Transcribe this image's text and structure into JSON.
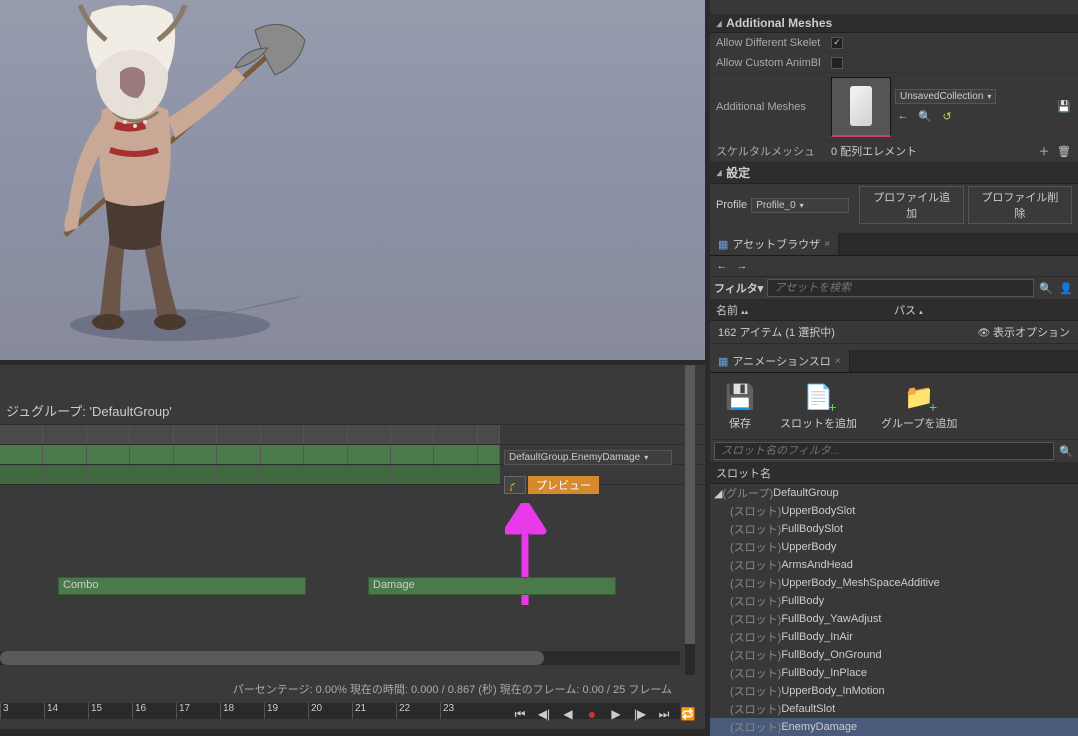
{
  "details": {
    "additional_meshes_header": "Additional Meshes",
    "allow_different_skeletons_label": "Allow Different Skelet",
    "allow_different_skeletons": true,
    "allow_custom_animbp_label": "Allow Custom AnimBl",
    "allow_custom_animbp": false,
    "additional_meshes_label": "Additional Meshes",
    "collection_dropdown": "UnsavedCollection",
    "skeletal_mesh_label": "スケルタルメッシュ",
    "array_elements": "0 配列エレメント",
    "settings_header": "設定",
    "profile_label": "Profile",
    "profile_value": "Profile_0",
    "add_profile": "プロファイル追加",
    "delete_profile": "プロファイル削除"
  },
  "asset_browser": {
    "tab": "アセットブラウザ",
    "filter_label": "フィルタ▾",
    "search_placeholder": "アセットを検索",
    "col_name": "名前",
    "col_path": "パス",
    "status": "162 アイテム (1 選択中)",
    "view_options": "表示オプション"
  },
  "slot_panel": {
    "tab": "アニメーションスロ",
    "save": "保存",
    "add_slot": "スロットを追加",
    "add_group": "グループを追加",
    "filter_placeholder": "スロット名のフィルタ...",
    "col_header": "スロット名",
    "group_prefix": "(グループ) ",
    "slot_prefix": "(スロット) ",
    "group": "DefaultGroup",
    "slots": [
      "UpperBodySlot",
      "FullBodySlot",
      "UpperBody",
      "ArmsAndHead",
      "UpperBody_MeshSpaceAdditive",
      "FullBody",
      "FullBody_YawAdjust",
      "FullBody_InAir",
      "FullBody_OnGround",
      "FullBody_InPlace",
      "UpperBody_InMotion",
      "DefaultSlot",
      "EnemyDamage"
    ]
  },
  "timeline": {
    "montage_group": "ジュグループ: 'DefaultGroup'",
    "slot_dropdown": "DefaultGroup.EnemyDamage",
    "preview": "プレビュー",
    "section1": "Combo",
    "section2": "Damage",
    "status": "パーセンテージ: 0.00%  現在の時間: 0.000 / 0.867 (秒)   現在のフレーム: 0.00 / 25 フレーム",
    "ticks": [
      "3",
      "14",
      "15",
      "16",
      "17",
      "18",
      "19",
      "20",
      "21",
      "22",
      "23"
    ]
  }
}
